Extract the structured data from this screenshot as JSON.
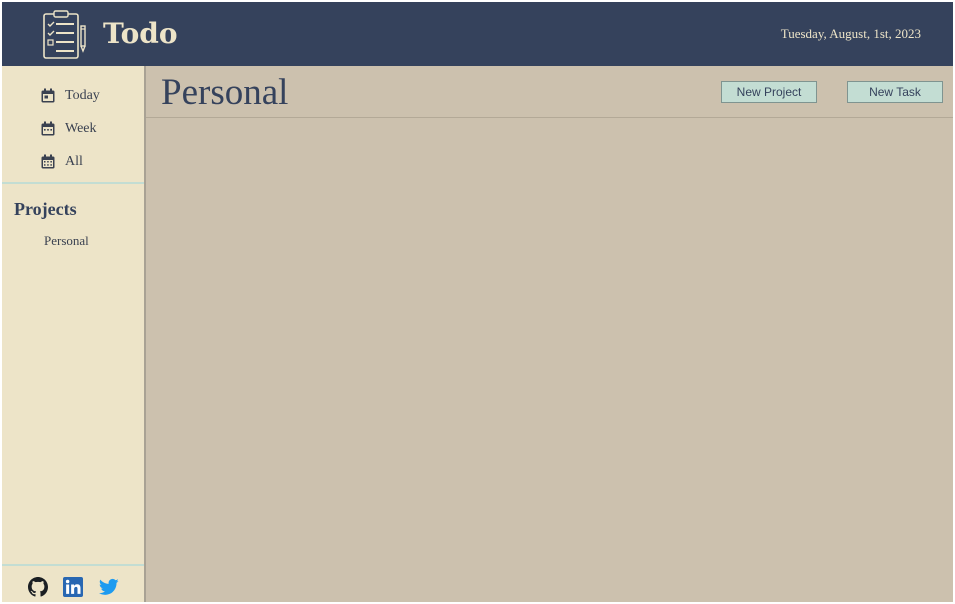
{
  "header": {
    "app_name": "Todo",
    "date": "Tuesday, August, 1st, 2023",
    "logo_icon": "checklist-clipboard-icon"
  },
  "sidebar": {
    "nav": [
      {
        "label": "Today",
        "icon": "calendar-day-icon"
      },
      {
        "label": "Week",
        "icon": "calendar-week-icon"
      },
      {
        "label": "All",
        "icon": "calendar-month-icon"
      }
    ],
    "projects_title": "Projects",
    "projects": [
      {
        "label": "Personal"
      }
    ],
    "socials": [
      {
        "icon": "github-icon"
      },
      {
        "icon": "linkedin-icon"
      },
      {
        "icon": "twitter-icon"
      }
    ]
  },
  "main": {
    "title": "Personal",
    "new_project_label": "New Project",
    "new_task_label": "New Task"
  },
  "colors": {
    "header_bg": "#35425c",
    "sidebar_bg": "#ede4c8",
    "main_bg": "#ccc1ae",
    "button_bg": "#c3ddd3",
    "linkedin": "#0a66c2",
    "twitter": "#1d9bf0"
  }
}
